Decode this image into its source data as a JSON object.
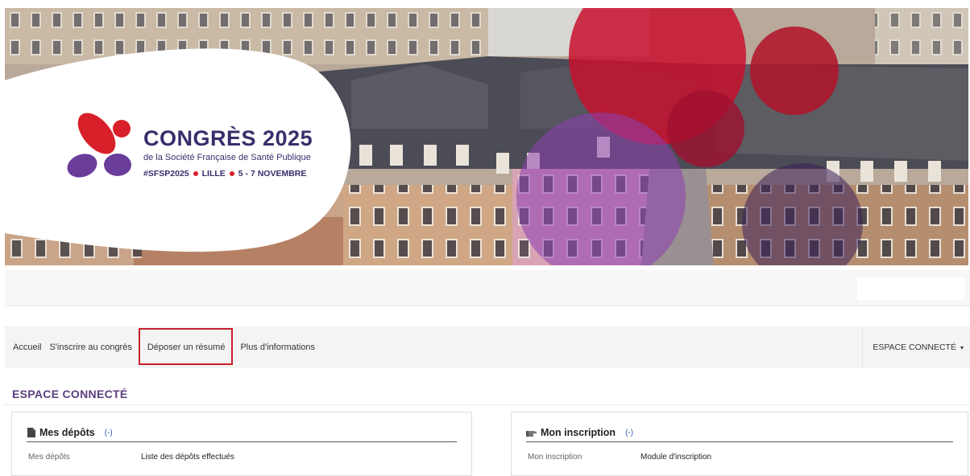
{
  "logo": {
    "title": "CONGRÈS 2025",
    "subtitle": "de la Société Française de Santé Publique",
    "hashtag": "#SFSP2025",
    "city": "LILLE",
    "dates": "5 - 7 NOVEMBRE"
  },
  "nav": {
    "items": [
      {
        "label": "Accueil"
      },
      {
        "label": "S'inscrire au congrès"
      },
      {
        "label": "Déposer un résumé"
      },
      {
        "label": "Plus d'informations"
      }
    ],
    "account_label": "ESPACE CONNECTÉ",
    "caret": "▾"
  },
  "page": {
    "title": "ESPACE CONNECTÉ"
  },
  "panels": {
    "left": {
      "title": "Mes dépôts",
      "toggle": "(-)",
      "row_key": "Mes dépôts",
      "row_value": "Liste des dépôts effectués"
    },
    "right": {
      "title": "Mon inscription",
      "toggle": "(-)",
      "row_key": "Mon inscription",
      "row_value": "Module d'inscription"
    }
  },
  "colors": {
    "brand_purple": "#5c3f7e",
    "brand_red": "#d8202a",
    "highlight_red": "#c8202c",
    "logo_navy": "#3a2d6b"
  },
  "icons": {
    "left_panel": "document-icon",
    "right_panel": "pointing-hand-icon"
  }
}
